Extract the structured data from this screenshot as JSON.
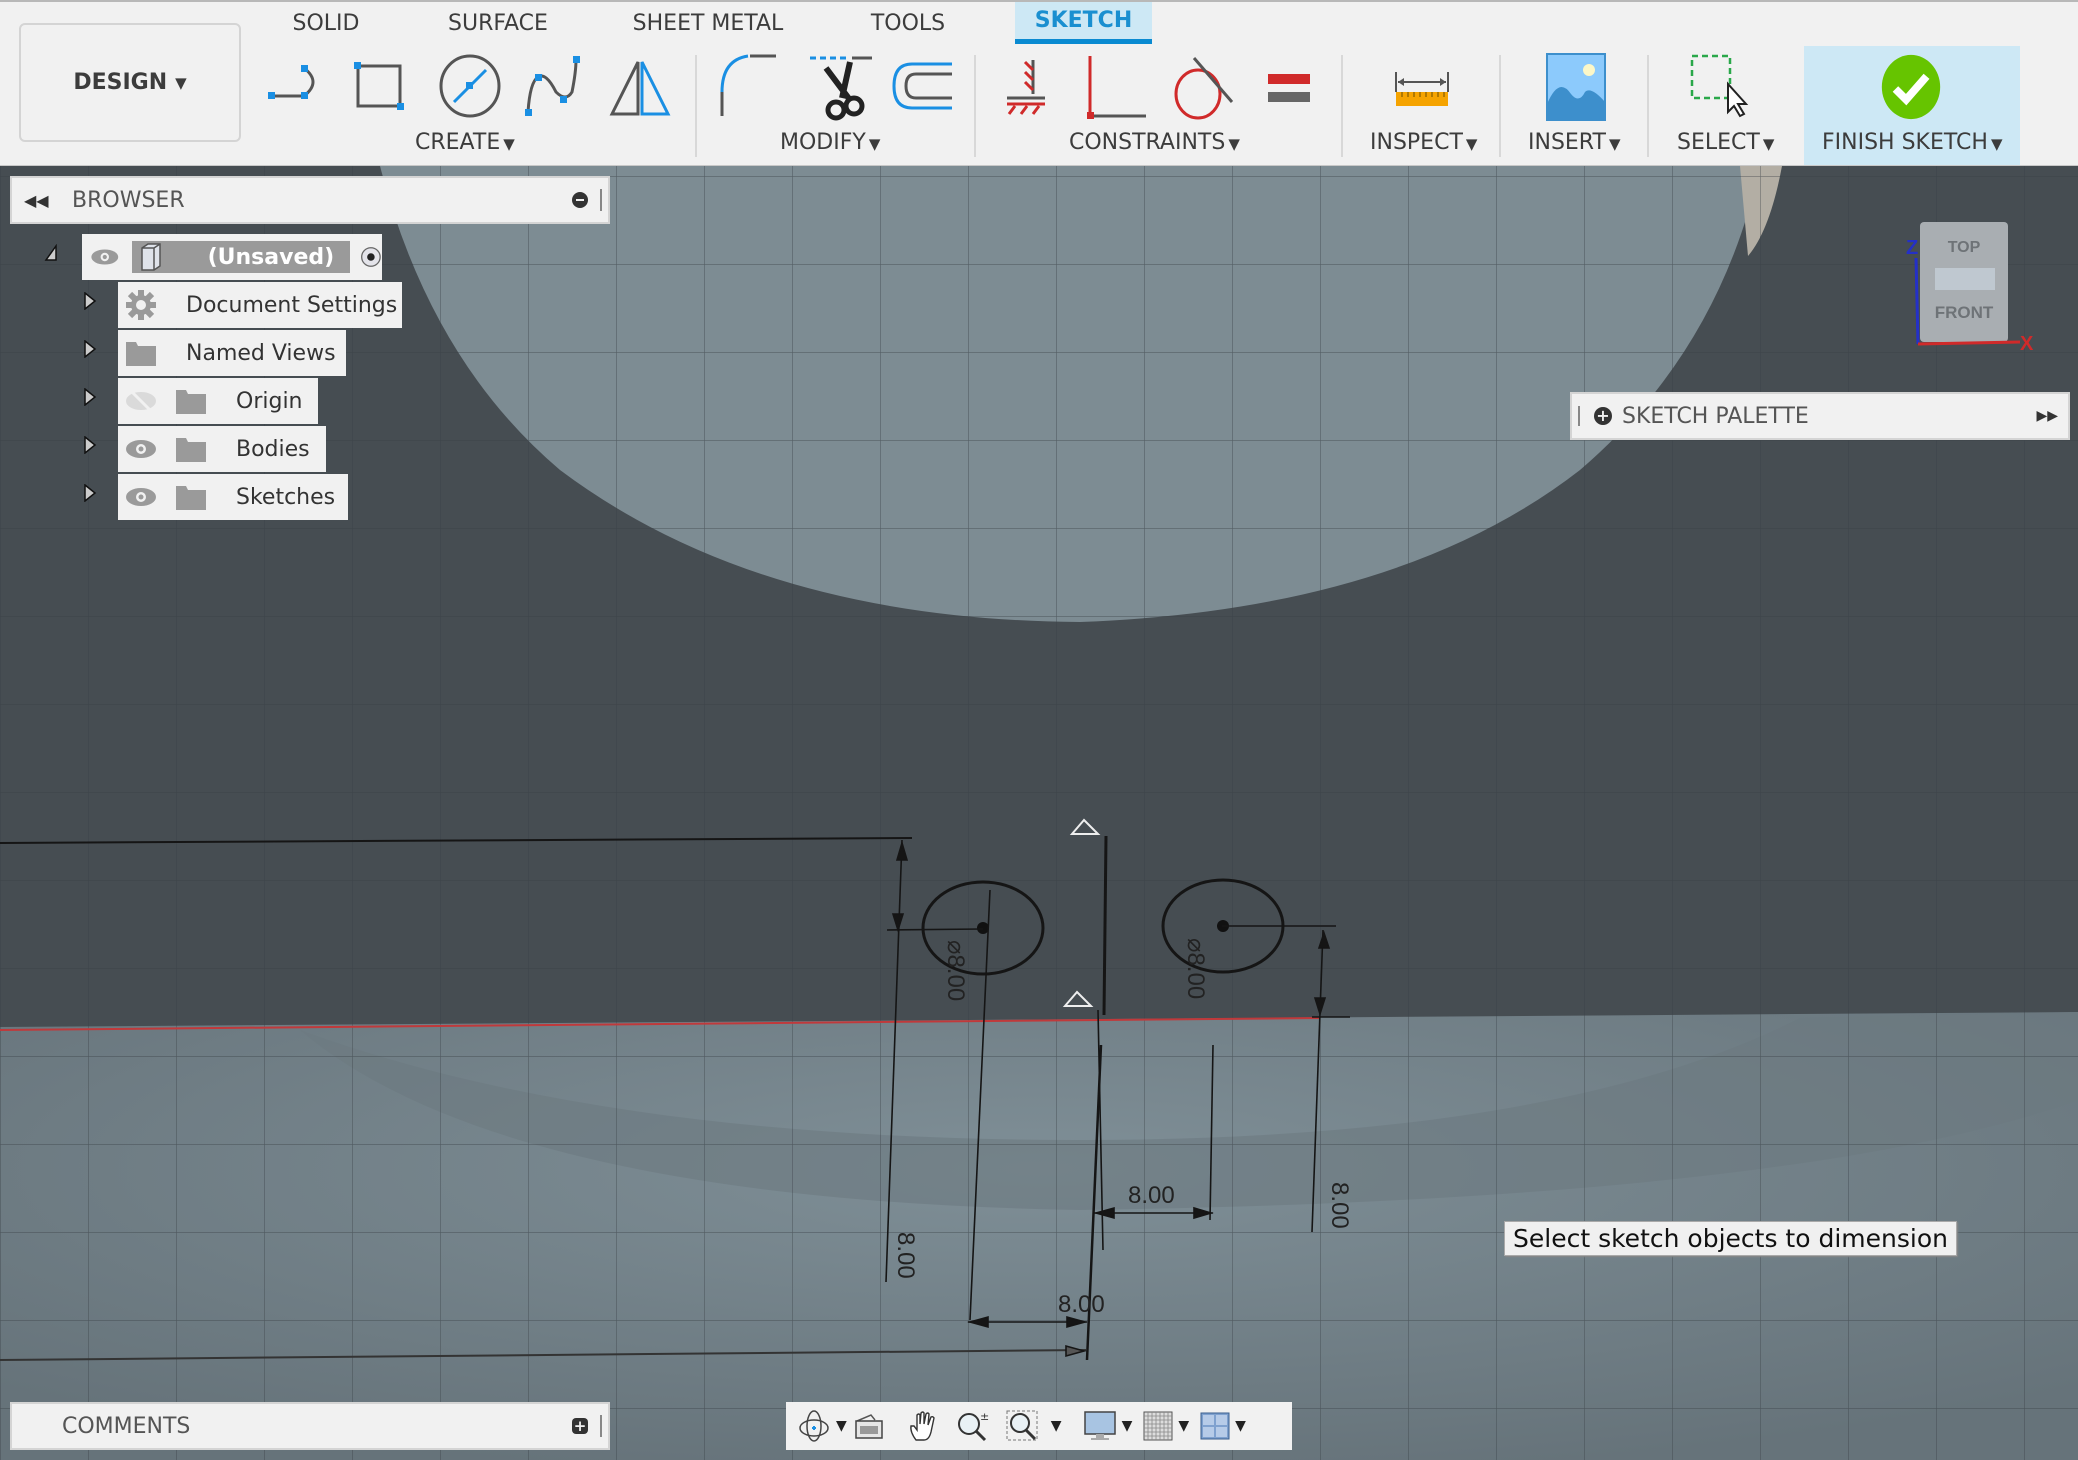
{
  "workspace": {
    "label": "DESIGN"
  },
  "tabs": [
    {
      "label": "SOLID",
      "active": false
    },
    {
      "label": "SURFACE",
      "active": false
    },
    {
      "label": "SHEET METAL",
      "active": false
    },
    {
      "label": "TOOLS",
      "active": false
    },
    {
      "label": "SKETCH",
      "active": true
    }
  ],
  "groups": {
    "create": {
      "label": "CREATE",
      "tools": [
        "line-icon",
        "rectangle-icon",
        "circle-icon",
        "spline-icon",
        "mirror-icon"
      ]
    },
    "modify": {
      "label": "MODIFY",
      "tools": [
        "fillet-icon",
        "trim-icon",
        "offset-icon"
      ]
    },
    "constraints": {
      "label": "CONSTRAINTS",
      "tools": [
        "fix-icon",
        "perpendicular-icon",
        "tangent-icon",
        "equal-icon"
      ]
    },
    "inspect": {
      "label": "INSPECT"
    },
    "insert": {
      "label": "INSERT"
    },
    "select": {
      "label": "SELECT"
    },
    "finish": {
      "label": "FINISH SKETCH"
    }
  },
  "browser": {
    "title": "BROWSER",
    "root": {
      "label": "(Unsaved)"
    },
    "items": [
      {
        "label": "Document Settings",
        "icon": "gear-icon"
      },
      {
        "label": "Named Views",
        "icon": "folder-icon"
      },
      {
        "label": "Origin",
        "icon": "folder-icon",
        "visibility": "hidden"
      },
      {
        "label": "Bodies",
        "icon": "folder-icon",
        "visibility": "visible"
      },
      {
        "label": "Sketches",
        "icon": "folder-icon",
        "visibility": "visible"
      }
    ]
  },
  "sketch_palette": {
    "title": "SKETCH PALETTE"
  },
  "comments": {
    "title": "COMMENTS"
  },
  "viewcube": {
    "top": "TOP",
    "front": "FRONT",
    "axis_z": "Z",
    "axis_x": "X"
  },
  "dimensions": {
    "diameter_left": "⌀8.00",
    "diameter_right": "⌀8.00",
    "horizontal_upper": "8.00",
    "horizontal_lower": "8.00",
    "vertical_left": "8.00",
    "vertical_right": "8.00"
  },
  "tooltip": {
    "text": "Select sketch objects to dimension"
  },
  "colors": {
    "accent": "#0a8ad1",
    "active_tab_bg": "#cde8f5",
    "finish_green": "#66c400",
    "constraint_red": "#d02a2a",
    "viewport_dark": "#464d52",
    "viewport_light": "#7d8c93"
  }
}
